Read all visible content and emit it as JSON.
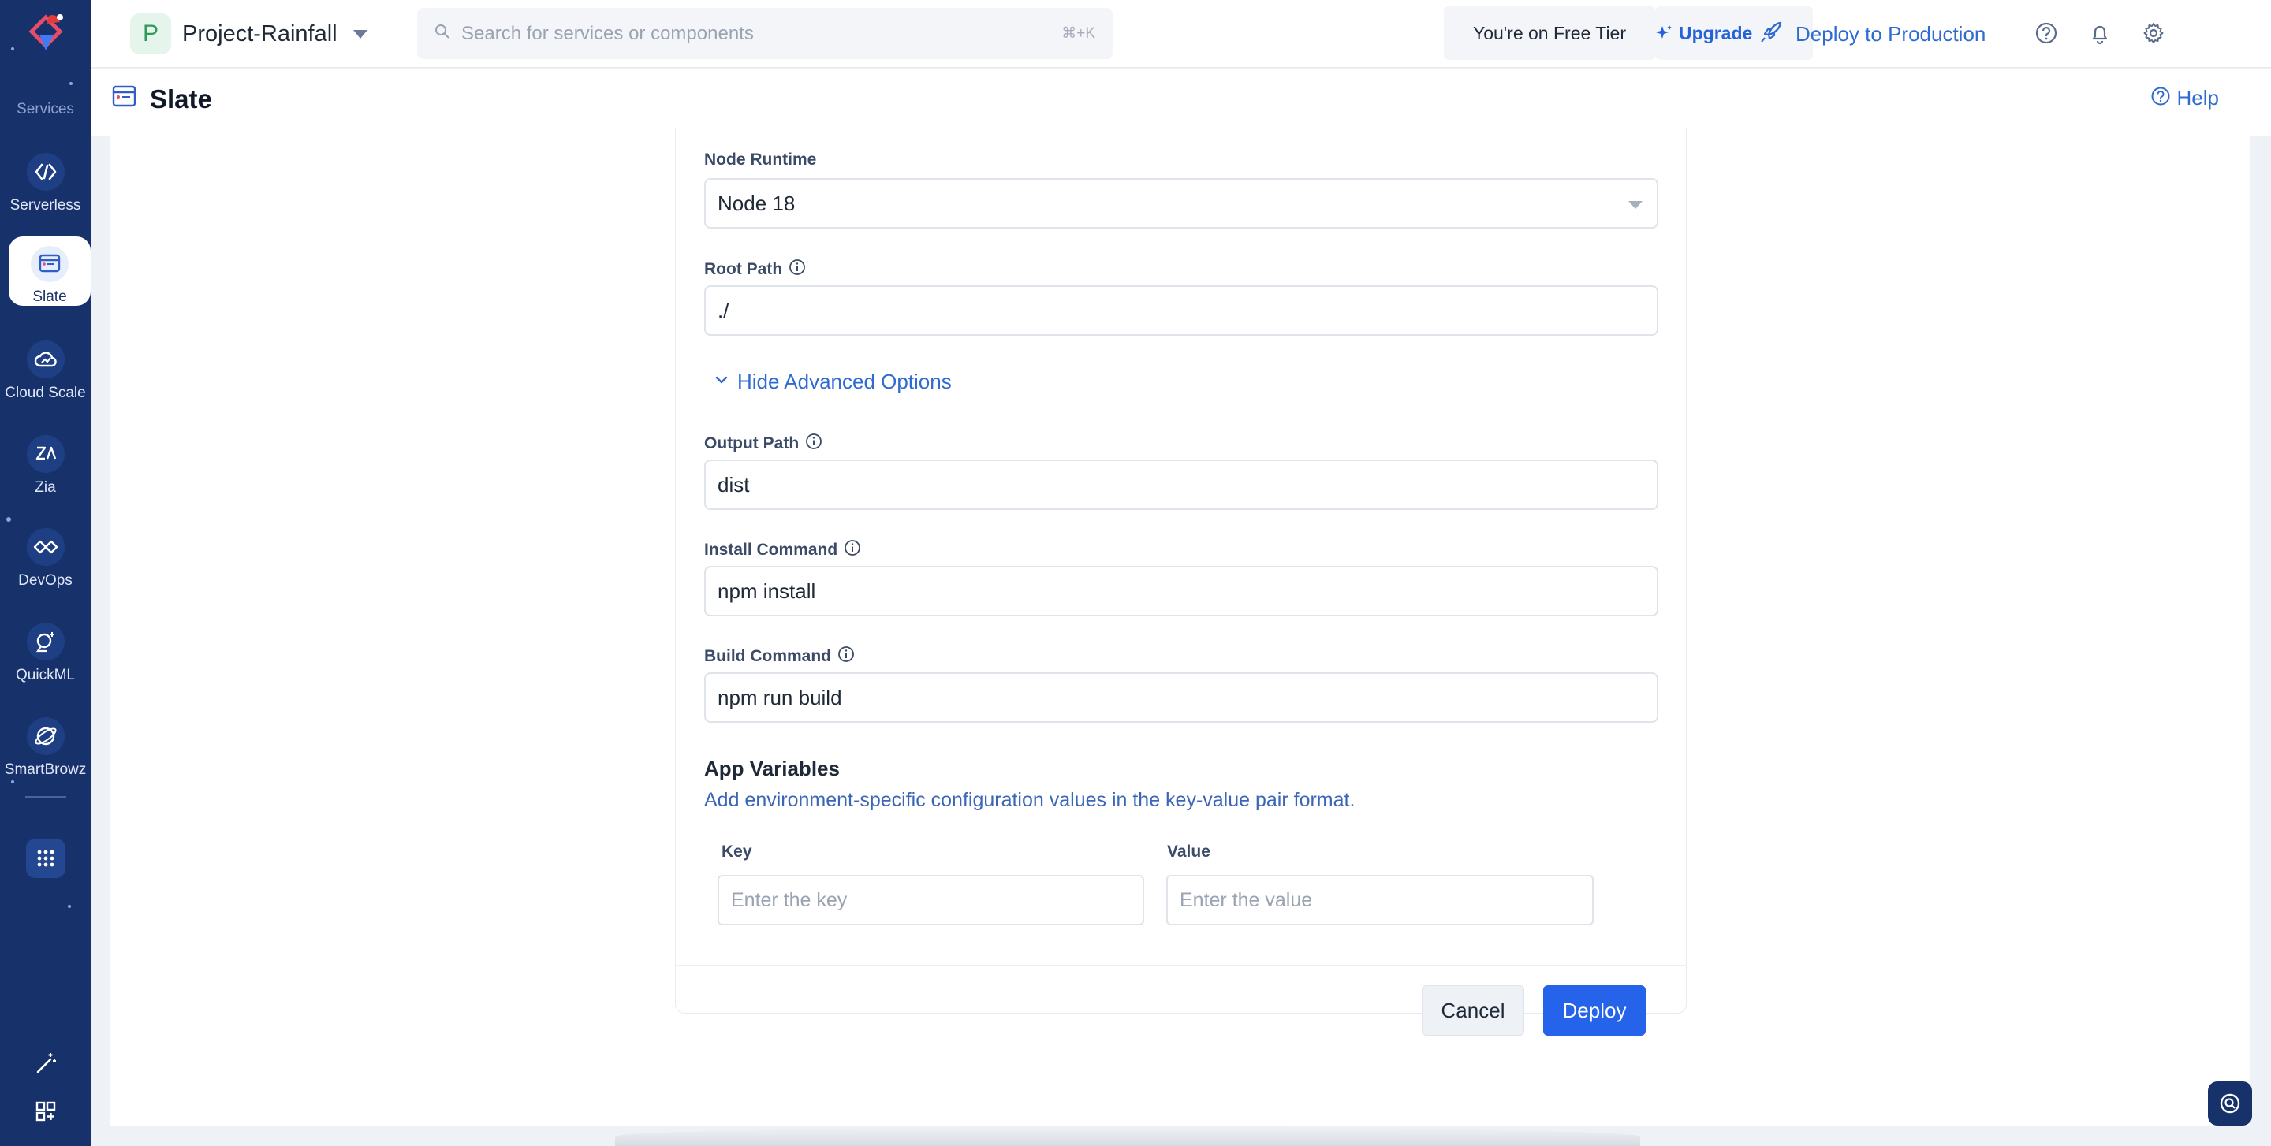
{
  "rail": {
    "section_label": "Services",
    "items": [
      {
        "label": "Serverless",
        "icon": "serverless-icon"
      },
      {
        "label": "Slate",
        "icon": "slate-icon"
      },
      {
        "label": "Cloud Scale",
        "icon": "cloud-scale-icon"
      },
      {
        "label": "Zia",
        "icon": "zia-icon"
      },
      {
        "label": "DevOps",
        "icon": "devops-icon"
      },
      {
        "label": "QuickML",
        "icon": "quickml-icon"
      },
      {
        "label": "SmartBrowz",
        "icon": "smartbrowz-icon"
      }
    ],
    "active_item": "Slate"
  },
  "header": {
    "project_initial": "P",
    "project_name": "Project-Rainfall",
    "search_placeholder": "Search for services or components",
    "search_shortcut": "⌘+K",
    "tier_text": "You're on Free Tier",
    "upgrade_label": "Upgrade",
    "deploy_label": "Deploy to Production"
  },
  "page": {
    "title": "Slate",
    "help_label": "Help"
  },
  "form": {
    "node_runtime": {
      "label": "Node Runtime",
      "value": "Node 18"
    },
    "root_path": {
      "label": "Root Path",
      "value": "./"
    },
    "advanced_toggle_label": "Hide Advanced Options",
    "output_path": {
      "label": "Output Path",
      "value": "dist"
    },
    "install_command": {
      "label": "Install Command",
      "value": "npm install"
    },
    "build_command": {
      "label": "Build Command",
      "value": "npm run build"
    },
    "app_variables": {
      "title": "App Variables",
      "description": "Add environment-specific configuration values in the key-value pair format.",
      "key_label": "Key",
      "value_label": "Value",
      "key_placeholder": "Enter the key",
      "value_placeholder": "Enter the value"
    },
    "cancel_label": "Cancel",
    "deploy_label": "Deploy"
  },
  "colors": {
    "rail_bg": "#17316b",
    "accent": "#2563eb",
    "link": "#2f6bd1"
  }
}
